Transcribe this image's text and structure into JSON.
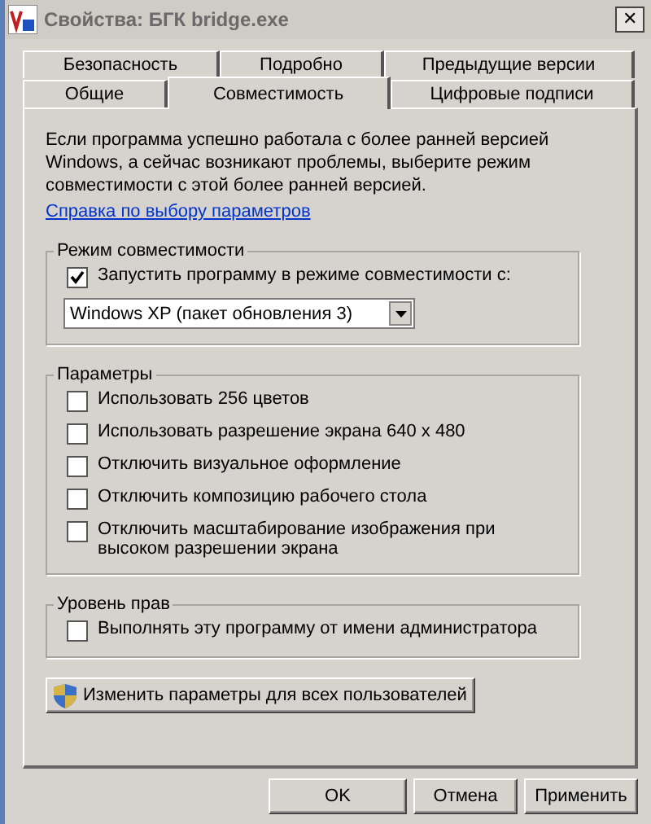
{
  "window": {
    "title": "Свойства: БГК bridge.exe",
    "close": "✕"
  },
  "tab_rows": [
    [
      {
        "label": "Безопасность",
        "selected": false
      },
      {
        "label": "Подробно",
        "selected": false
      },
      {
        "label": "Предыдущие версии",
        "selected": false
      }
    ],
    [
      {
        "label": "Общие",
        "selected": false
      },
      {
        "label": "Совместимость",
        "selected": true
      },
      {
        "label": "Цифровые подписи",
        "selected": false
      }
    ]
  ],
  "intro": "Если программа успешно работала с более ранней версией Windows, а сейчас возникают проблемы, выберите режим совместимости с этой более ранней версией.",
  "help_link": "Справка по выбору параметров",
  "groups": [
    {
      "title": "Режим совместимости",
      "items": [
        {
          "kind": "checkbox",
          "label": "Запустить программу в режиме совместимости с:",
          "checked": true
        },
        {
          "kind": "dropdown",
          "value": "Windows XP (пакет обновления 3)"
        }
      ]
    },
    {
      "title": "Параметры",
      "items": [
        {
          "kind": "checkbox",
          "label": "Использовать 256 цветов",
          "checked": false
        },
        {
          "kind": "checkbox",
          "label": "Использовать разрешение экрана 640 x 480",
          "checked": false
        },
        {
          "kind": "checkbox",
          "label": "Отключить визуальное оформление",
          "checked": false
        },
        {
          "kind": "checkbox",
          "label": "Отключить композицию рабочего стола",
          "checked": false
        },
        {
          "kind": "checkbox",
          "label": "Отключить масштабирование изображения при высоком разрешении экрана",
          "checked": false
        }
      ]
    },
    {
      "title": "Уровень прав",
      "items": [
        {
          "kind": "checkbox",
          "label": "Выполнять эту программу от имени администратора",
          "checked": false
        }
      ]
    }
  ],
  "all_users_button": "Изменить параметры для всех пользователей",
  "buttons": [
    "OK",
    "Отмена",
    "Применить"
  ]
}
